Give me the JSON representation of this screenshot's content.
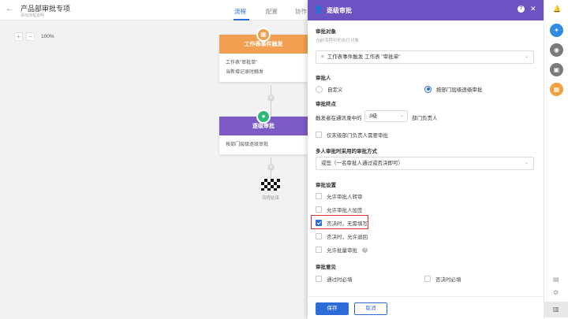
{
  "header": {
    "back_icon": "arrow-left-icon",
    "title": "产品部审批专项",
    "subtitle": "添加流程说明",
    "tabs": [
      {
        "label": "流程",
        "active": true
      },
      {
        "label": "配置",
        "active": false
      },
      {
        "label": "协作",
        "active": false
      }
    ]
  },
  "canvas": {
    "zoom": {
      "minus": "−",
      "plus": "+",
      "value": "100%"
    },
    "trigger_node": {
      "icon": "grid-icon",
      "title": "工作表事件触发",
      "lines": [
        "工作表\"审批单\"",
        "当新增记录时触发"
      ],
      "color": "#f0a050"
    },
    "approval_node": {
      "icon": "user-icon",
      "title": "逐级审批",
      "lines": [
        "按部门层级逐级审批"
      ],
      "color": "#7c5cc4"
    },
    "end_label": "流程结束"
  },
  "panel": {
    "title": "逐级审批",
    "header_color": "#6d52c1",
    "target": {
      "label": "审批对象",
      "hint": "当前流程中的执行对象",
      "value": "工作表事件触发 工作表 \"审批单\""
    },
    "approver": {
      "label": "审批人",
      "options": [
        {
          "label": "自定义",
          "selected": false
        },
        {
          "label": "按部门层级逐级审批",
          "selected": true
        }
      ]
    },
    "end_point": {
      "label": "审批终点",
      "prefix": "触发者在通讯录中的",
      "level_value": "3级",
      "suffix": "部门负责人",
      "only_dept_head": "仅末级部门负责人需要审批"
    },
    "multi_method": {
      "label": "多人审批时采用的审批方式",
      "value": "或签（一名审批人通过或否决即可）"
    },
    "settings": {
      "label": "审批设置",
      "items": [
        {
          "label": "允许审批人转审",
          "checked": false,
          "info": false
        },
        {
          "label": "允许审批人加签",
          "checked": false,
          "info": false
        },
        {
          "label": "否决时，无需填写",
          "checked": true,
          "info": false
        },
        {
          "label": "否决时，允许退回",
          "checked": false,
          "info": false
        },
        {
          "label": "允许批量审批",
          "checked": false,
          "info": true
        }
      ]
    },
    "opinion": {
      "label": "审批意见",
      "options": [
        {
          "label": "通过时必填",
          "checked": false
        },
        {
          "label": "否决时必填",
          "checked": false
        }
      ]
    },
    "footer": {
      "save": "保存",
      "cancel": "取消"
    }
  },
  "rail": {
    "items": [
      {
        "icon": "bell-icon",
        "color": "#888888"
      },
      {
        "icon": "ai-assistant-icon",
        "color": "#2d8ce0"
      },
      {
        "icon": "notification-icon",
        "color": "#7a7a7a"
      },
      {
        "icon": "briefcase-icon",
        "color": "#7a7a7a"
      },
      {
        "icon": "apps-icon",
        "color": "#f0a040"
      }
    ]
  },
  "colors": {
    "primary": "#2d6bd6",
    "highlight": "#e03030"
  }
}
